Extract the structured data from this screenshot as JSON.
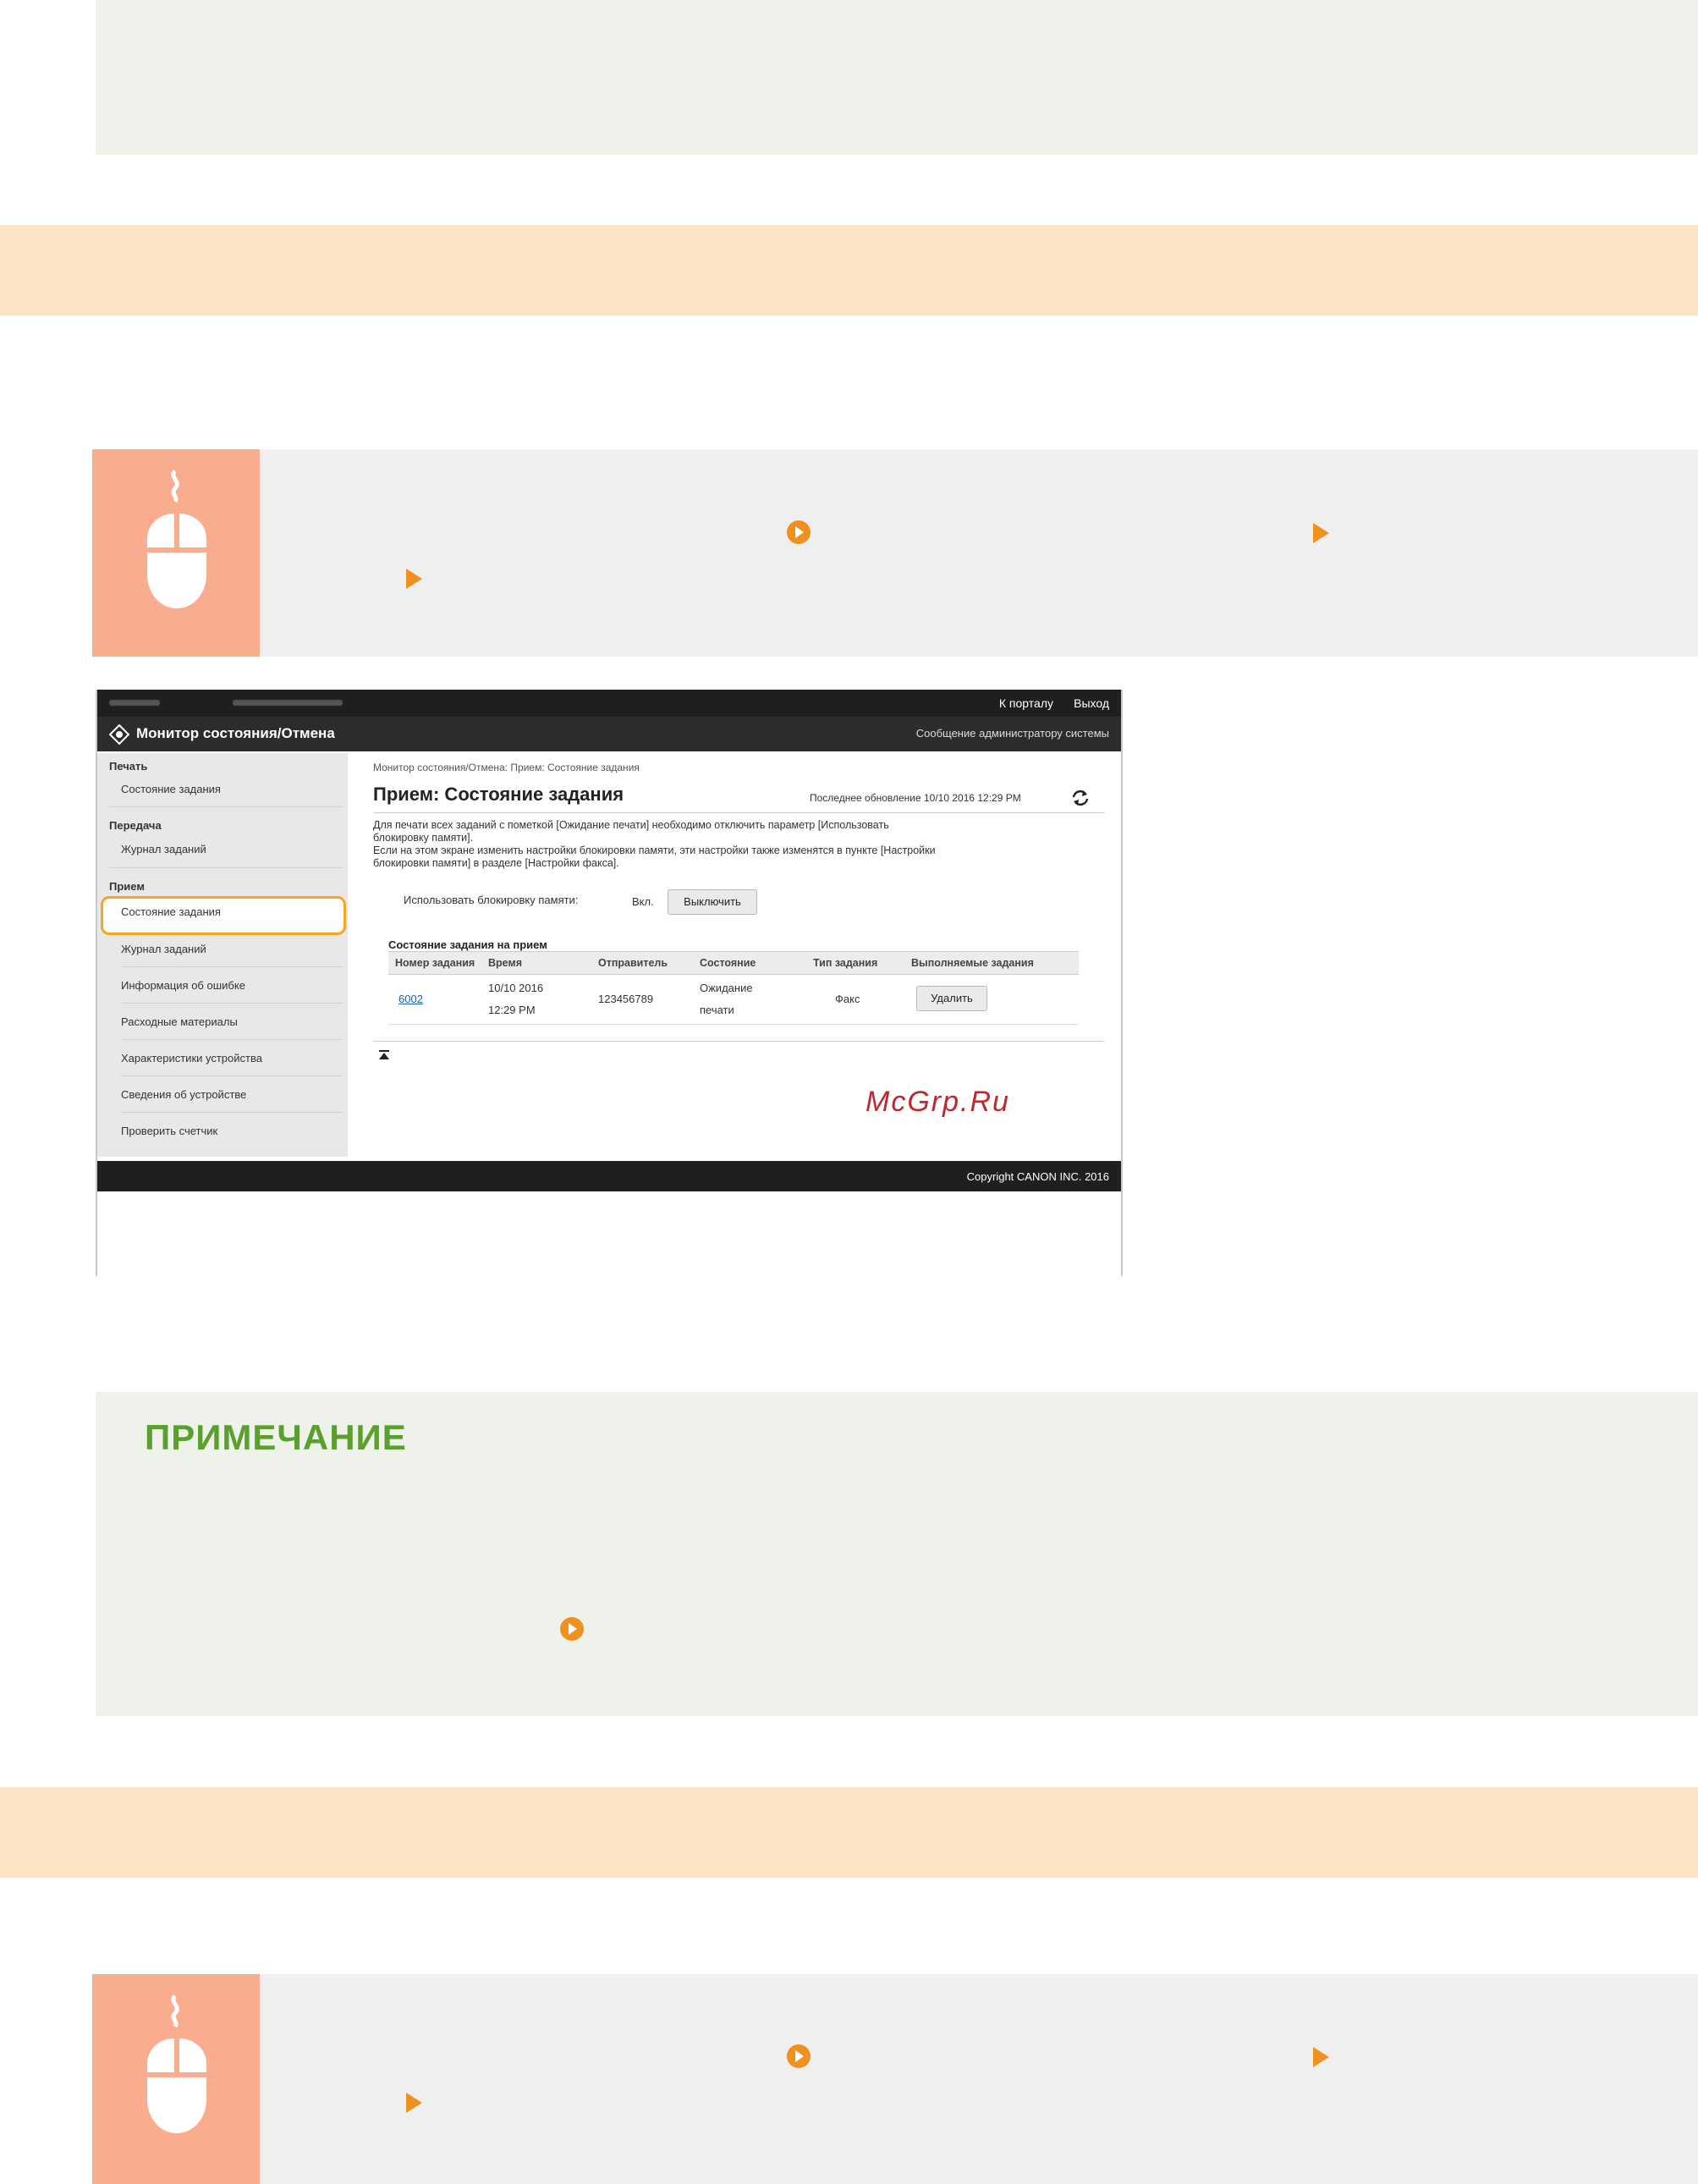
{
  "note_heading": "ПРИМЕЧАНИЕ",
  "watermark": "McGrp.Ru",
  "icons": {
    "operation": "mouse-icon",
    "link_marker": "circle-arrow-icon",
    "step_marker": "triangle-arrow-icon"
  },
  "colors": {
    "section_bar": "#fbe3c5",
    "icon_box": "#f9ac8e",
    "marker": "#f0901e",
    "note_bg": "#eef2ea",
    "note_title": "#5aa02c"
  },
  "screenshot": {
    "topbar": {
      "link_login": "К порталу",
      "link_logout": "Выход"
    },
    "title": "Монитор состояния/Отмена",
    "admin_link": "Сообщение администратору системы",
    "sidebar": {
      "cat_print": "Печать",
      "print_status": "Состояние задания",
      "cat_send": "Передача",
      "send_log": "Журнал заданий",
      "cat_receive": "Прием",
      "items": [
        "Состояние задания",
        "Журнал заданий",
        "Информация об ошибке",
        "Расходные материалы",
        "Характеристики устройства",
        "Сведения об устройстве",
        "Проверить счетчик"
      ]
    },
    "breadcrumb": "Монитор состояния/Отмена: Прием: Состояние задания",
    "page_title": "Прием: Состояние задания",
    "last_update": "Последнее обновление 10/10 2016 12:29 PM",
    "description": [
      "Для печати всех заданий с пометкой [Ожидание печати] необходимо отключить параметр [Использовать",
      "блокировку памяти].",
      "Если на этом экране изменить настройки блокировки памяти, эти настройки также изменятся в пункте [Настройки",
      "блокировки памяти] в разделе [Настройки факса]."
    ],
    "memory_lock": {
      "label": "Использовать блокировку памяти:",
      "value": "Вкл.",
      "button": "Выключить"
    },
    "table_caption": "Состояние задания на прием",
    "table": {
      "headers": [
        "Номер задания",
        "Время",
        "Отправитель",
        "Состояние",
        "Тип задания",
        "Выполняемые задания"
      ],
      "row": {
        "job_number": "6002",
        "time_line1": "10/10 2016",
        "time_line2": "12:29 PM",
        "sender": "123456789",
        "status_line1": "Ожидание",
        "status_line2": "печати",
        "type": "Факс",
        "action": "Удалить"
      }
    },
    "footer": "Copyright CANON INC. 2016"
  }
}
